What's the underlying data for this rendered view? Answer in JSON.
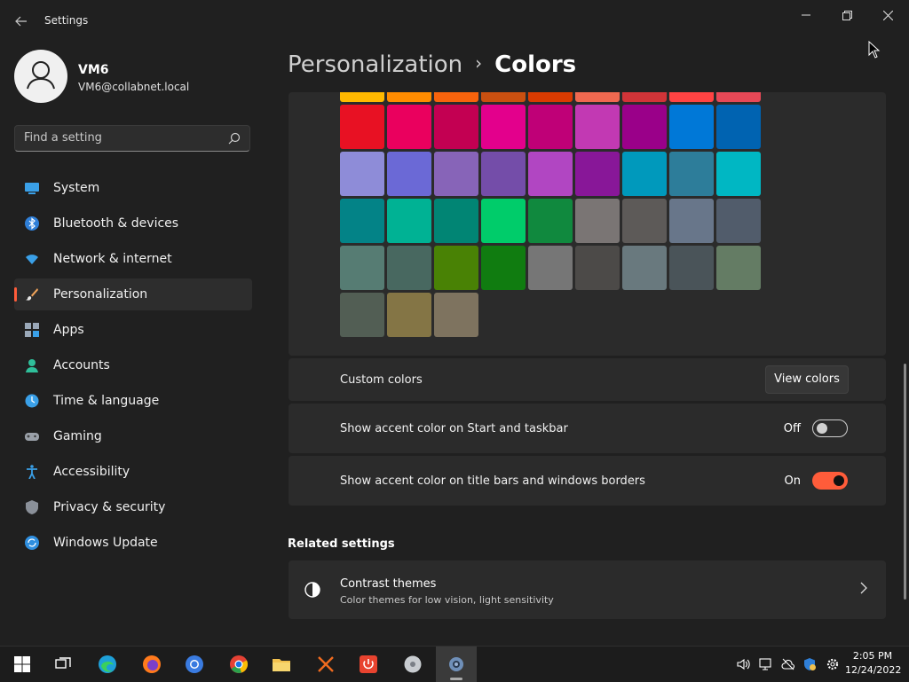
{
  "window": {
    "title": "Settings",
    "back_icon": "back-arrow-icon",
    "controls": [
      "minimize-icon",
      "maximize-icon",
      "close-icon"
    ]
  },
  "profile": {
    "name": "VM6",
    "email": "VM6@collabnet.local"
  },
  "search": {
    "placeholder": "Find a setting"
  },
  "nav": {
    "items": [
      {
        "label": "System",
        "icon": "system-icon"
      },
      {
        "label": "Bluetooth & devices",
        "icon": "bluetooth-icon"
      },
      {
        "label": "Network & internet",
        "icon": "wifi-icon"
      },
      {
        "label": "Personalization",
        "icon": "brush-icon",
        "active": true
      },
      {
        "label": "Apps",
        "icon": "apps-icon"
      },
      {
        "label": "Accounts",
        "icon": "accounts-icon"
      },
      {
        "label": "Time & language",
        "icon": "time-language-icon"
      },
      {
        "label": "Gaming",
        "icon": "gaming-icon"
      },
      {
        "label": "Accessibility",
        "icon": "accessibility-icon"
      },
      {
        "label": "Privacy & security",
        "icon": "shield-icon"
      },
      {
        "label": "Windows Update",
        "icon": "update-icon"
      }
    ]
  },
  "breadcrumb": {
    "parent": "Personalization",
    "separator": "›",
    "current": "Colors"
  },
  "accent_colors": {
    "rows": [
      [
        "#FFB900",
        "#FF8C00",
        "#F7630C",
        "#CA5010",
        "#DA3B01",
        "#EF6950",
        "#D13438",
        "#FF4343",
        "#E74856"
      ],
      [
        "#E81123",
        "#EA005E",
        "#C30052",
        "#E3008C",
        "#BF0077",
        "#C239B3",
        "#9A0089",
        "#0078D7",
        "#0063B1"
      ],
      [
        "#8E8CD8",
        "#6B69D6",
        "#8764B8",
        "#744DA9",
        "#B146C2",
        "#881798",
        "#0099BC",
        "#2D7D9A",
        "#00B7C3"
      ],
      [
        "#038387",
        "#00B294",
        "#018574",
        "#00CC6A",
        "#10893E",
        "#7A7574",
        "#5D5A58",
        "#68768A",
        "#515C6B"
      ],
      [
        "#567C73",
        "#486860",
        "#498205",
        "#107C10",
        "#767676",
        "#4C4A48",
        "#69797E",
        "#4A5459",
        "#647C64"
      ],
      [
        "#525E54",
        "#847545",
        "#7E735F"
      ]
    ]
  },
  "custom_colors": {
    "label": "Custom colors",
    "button": "View colors"
  },
  "toggles": [
    {
      "label": "Show accent color on Start and taskbar",
      "state_text": "Off",
      "on": false
    },
    {
      "label": "Show accent color on title bars and windows borders",
      "state_text": "On",
      "on": true
    }
  ],
  "related": {
    "heading": "Related settings",
    "items": [
      {
        "title": "Contrast themes",
        "subtitle": "Color themes for low vision, light sensitivity",
        "icon": "contrast-icon"
      }
    ]
  },
  "taskbar": {
    "apps": [
      "windows-start-icon",
      "task-view-icon",
      "edge-icon",
      "firefox-icon",
      "chromium-icon",
      "chrome-icon",
      "file-explorer-icon",
      "x-app-icon",
      "power-app-icon",
      "disk-app-icon",
      "settings-icon"
    ],
    "tray": [
      "volume-icon",
      "network-icon",
      "cloud-icon",
      "security-icon",
      "gear-icon"
    ],
    "time": "2:05 PM",
    "date": "12/24/2022"
  },
  "theme": {
    "accent": "#FF5C3A",
    "background": "#202020",
    "card": "#2B2B2B"
  }
}
